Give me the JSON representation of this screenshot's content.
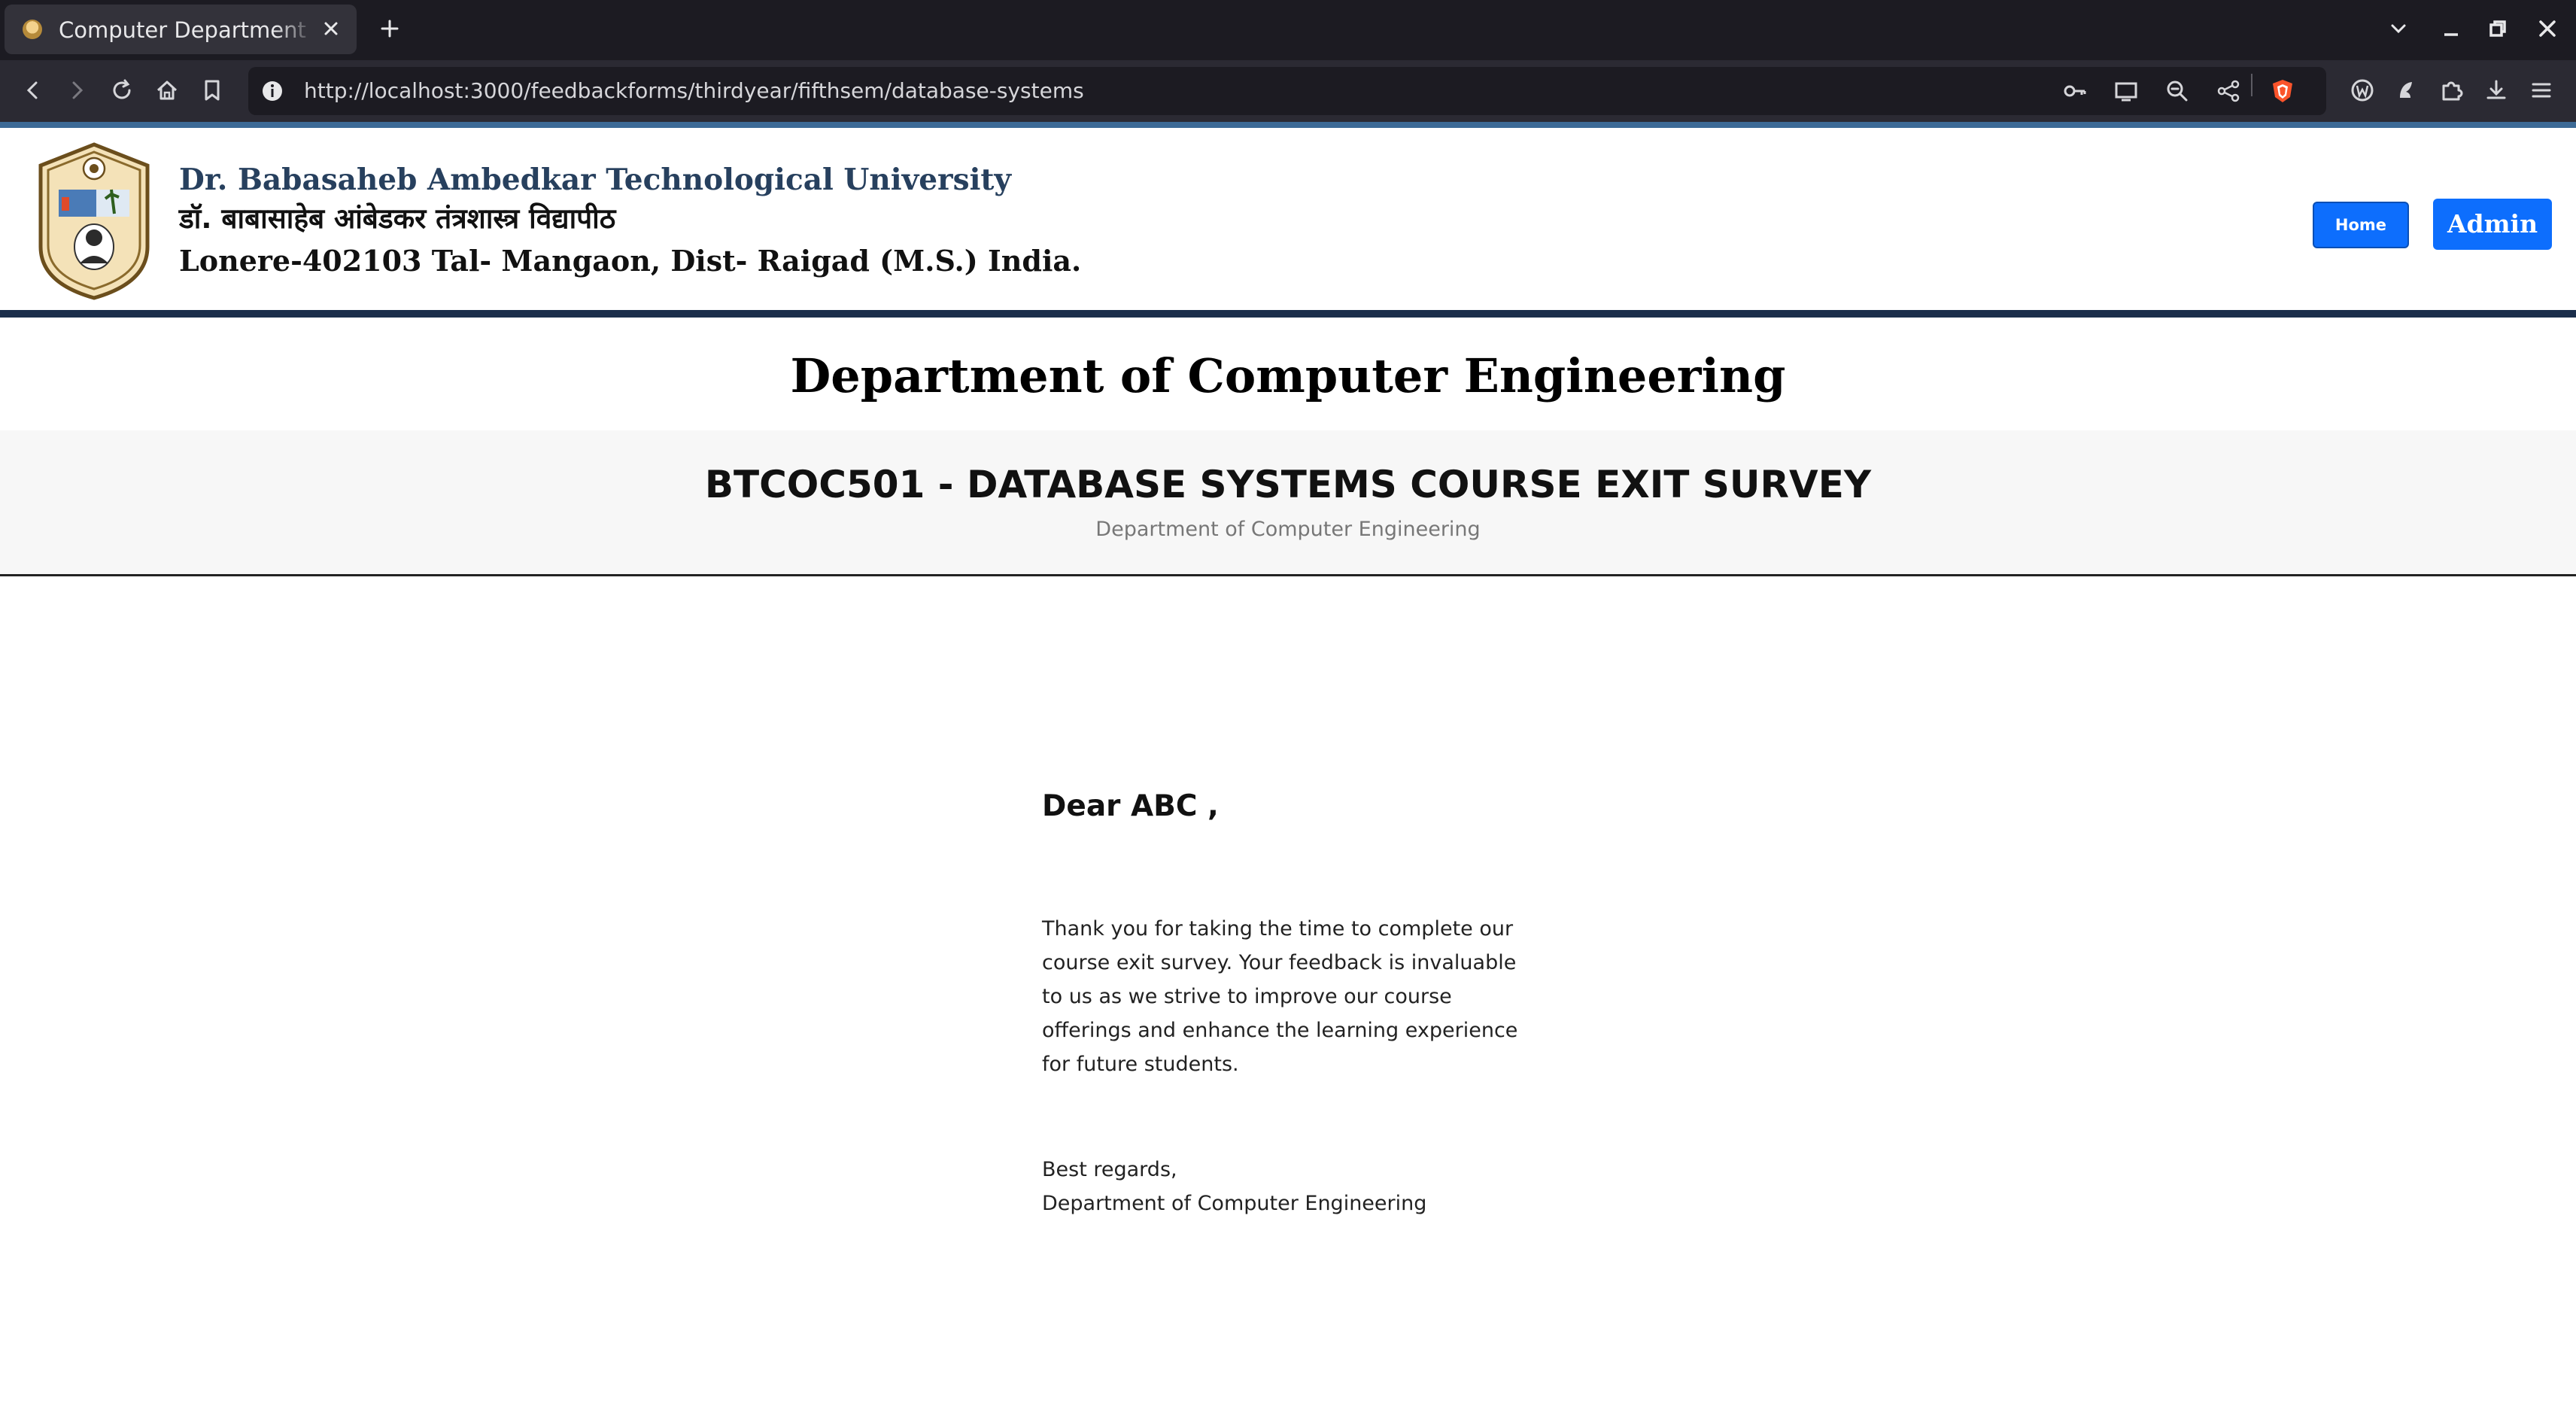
{
  "browser": {
    "tab_title": "Computer Department Course Exit Survey",
    "url": "http://localhost:3000/feedbackforms/thirdyear/fifthsem/database-systems",
    "icons": [
      "back-icon",
      "forward-icon",
      "reload-icon",
      "home-icon",
      "bookmark-icon",
      "info-icon",
      "key-icon",
      "cast-icon",
      "zoom-out-icon",
      "share-icon",
      "brave-shield-icon",
      "wallet-icon",
      "leo-icon",
      "extensions-icon",
      "download-icon",
      "menu-icon"
    ]
  },
  "header": {
    "university_en": "Dr. Babasaheb Ambedkar Technological University",
    "university_mr": "डॉ. बाबासाहेब आंबेडकर तंत्रशास्त्र विद्यापीठ",
    "address": "Lonere-402103 Tal- Mangaon, Dist- Raigad (M.S.) India.",
    "home_label": "Home",
    "admin_label": "Admin"
  },
  "page": {
    "department_title": "Department of Computer Engineering",
    "survey_title": "BTCOC501 - DATABASE SYSTEMS COURSE EXIT SURVEY",
    "survey_subtitle": "Department of Computer Engineering"
  },
  "letter": {
    "greeting": "Dear ABC ,",
    "message": "Thank you for taking the time to complete our course exit survey. Your feedback is invaluable to us as we strive to improve our course offerings and enhance the learning experience for future students.",
    "closing": "Best regards,",
    "signature": "Department of Computer Engineering"
  },
  "colors": {
    "header_border": "#1b2e4b",
    "university_name": "#27405e",
    "button_primary": "#0d6efd",
    "banner_bg": "#f7f7f7"
  }
}
